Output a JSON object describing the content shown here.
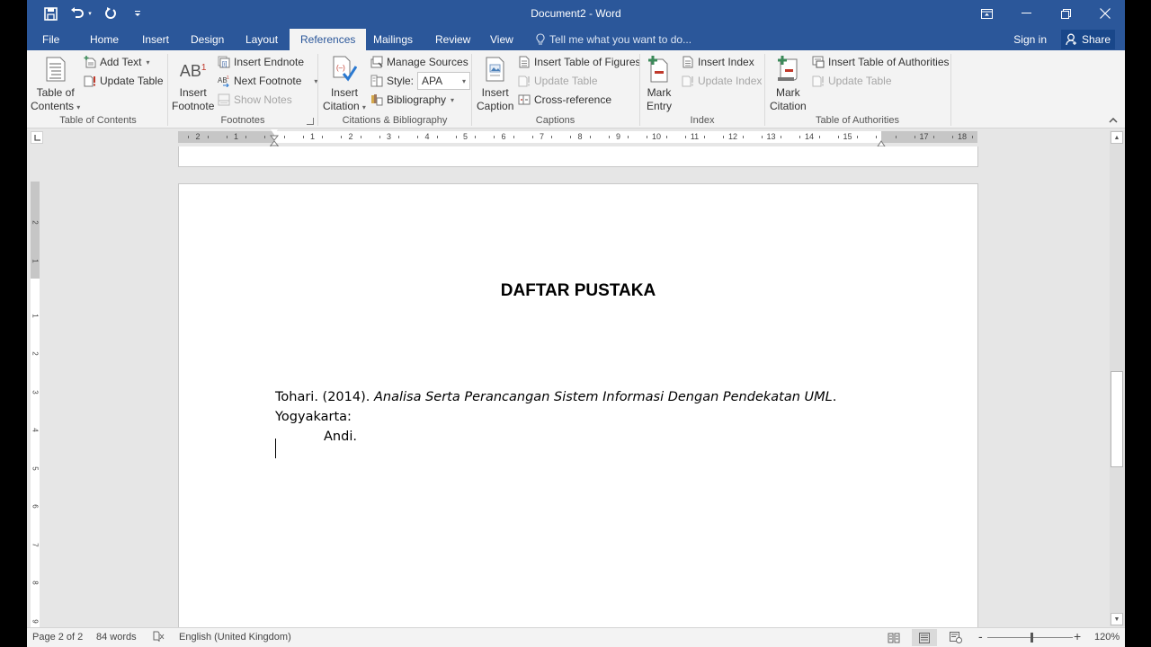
{
  "window": {
    "title": "Document2 - Word"
  },
  "qat": {
    "save_icon": "save-icon",
    "undo_icon": "undo-icon",
    "redo_icon": "repeat-icon",
    "customize_icon": "customize-qat-icon"
  },
  "tabs": [
    {
      "label": "File"
    },
    {
      "label": "Home"
    },
    {
      "label": "Insert"
    },
    {
      "label": "Design"
    },
    {
      "label": "Layout"
    },
    {
      "label": "References",
      "active": true
    },
    {
      "label": "Mailings"
    },
    {
      "label": "Review"
    },
    {
      "label": "View"
    }
  ],
  "tellme": {
    "placeholder": "Tell me what you want to do..."
  },
  "account": {
    "signin": "Sign in",
    "share": "Share"
  },
  "ribbon": {
    "groups": {
      "toc": {
        "label": "Table of Contents",
        "big_button": [
          "Table of",
          "Contents"
        ],
        "add_text": "Add Text",
        "update_table": "Update Table"
      },
      "footnotes": {
        "label": "Footnotes",
        "big_button": [
          "Insert",
          "Footnote"
        ],
        "big_icon_text": "AB",
        "big_icon_sup": "1",
        "insert_endnote": "Insert Endnote",
        "next_footnote": "Next Footnote",
        "show_notes": "Show Notes"
      },
      "citations": {
        "label": "Citations & Bibliography",
        "big_button": [
          "Insert",
          "Citation"
        ],
        "manage_sources": "Manage Sources",
        "style_label": "Style:",
        "style_value": "APA",
        "bibliography": "Bibliography"
      },
      "captions": {
        "label": "Captions",
        "big_button": [
          "Insert",
          "Caption"
        ],
        "insert_tof": "Insert Table of Figures",
        "update_table": "Update Table",
        "cross_reference": "Cross-reference"
      },
      "index": {
        "label": "Index",
        "big_button": [
          "Mark",
          "Entry"
        ],
        "insert_index": "Insert Index",
        "update_index": "Update Index"
      },
      "toa": {
        "label": "Table of Authorities",
        "big_button": [
          "Mark",
          "Citation"
        ],
        "insert_toa": "Insert Table of Authorities",
        "update_table": "Update Table"
      }
    }
  },
  "ruler": {
    "horizontal_left": [
      "2",
      "1"
    ],
    "horizontal": [
      "1",
      "2",
      "3",
      "4",
      "5",
      "6",
      "7",
      "8",
      "9",
      "10",
      "11",
      "12",
      "13",
      "14",
      "15"
    ],
    "horizontal_right": [
      "17",
      "18"
    ],
    "vertical_top": [
      "2",
      "1"
    ],
    "vertical": [
      "1",
      "2",
      "3",
      "4",
      "5",
      "6",
      "7",
      "8",
      "9"
    ]
  },
  "document": {
    "heading": "DAFTAR PUSTAKA",
    "reference": {
      "author_year": "Tohari. (2014). ",
      "title": "Analisa Serta Perancangan Sistem Informasi Dengan Pendekatan UML",
      "after_title": ". Yogyakarta:",
      "continuation": "Andi."
    }
  },
  "statusbar": {
    "page": "Page 2 of 2",
    "words": "84 words",
    "proofing_icon": "proofing-icon",
    "language": "English (United Kingdom)",
    "zoom_minus": "-",
    "zoom_plus": "+",
    "zoom_level": "120%",
    "zoom_percent": 120
  }
}
